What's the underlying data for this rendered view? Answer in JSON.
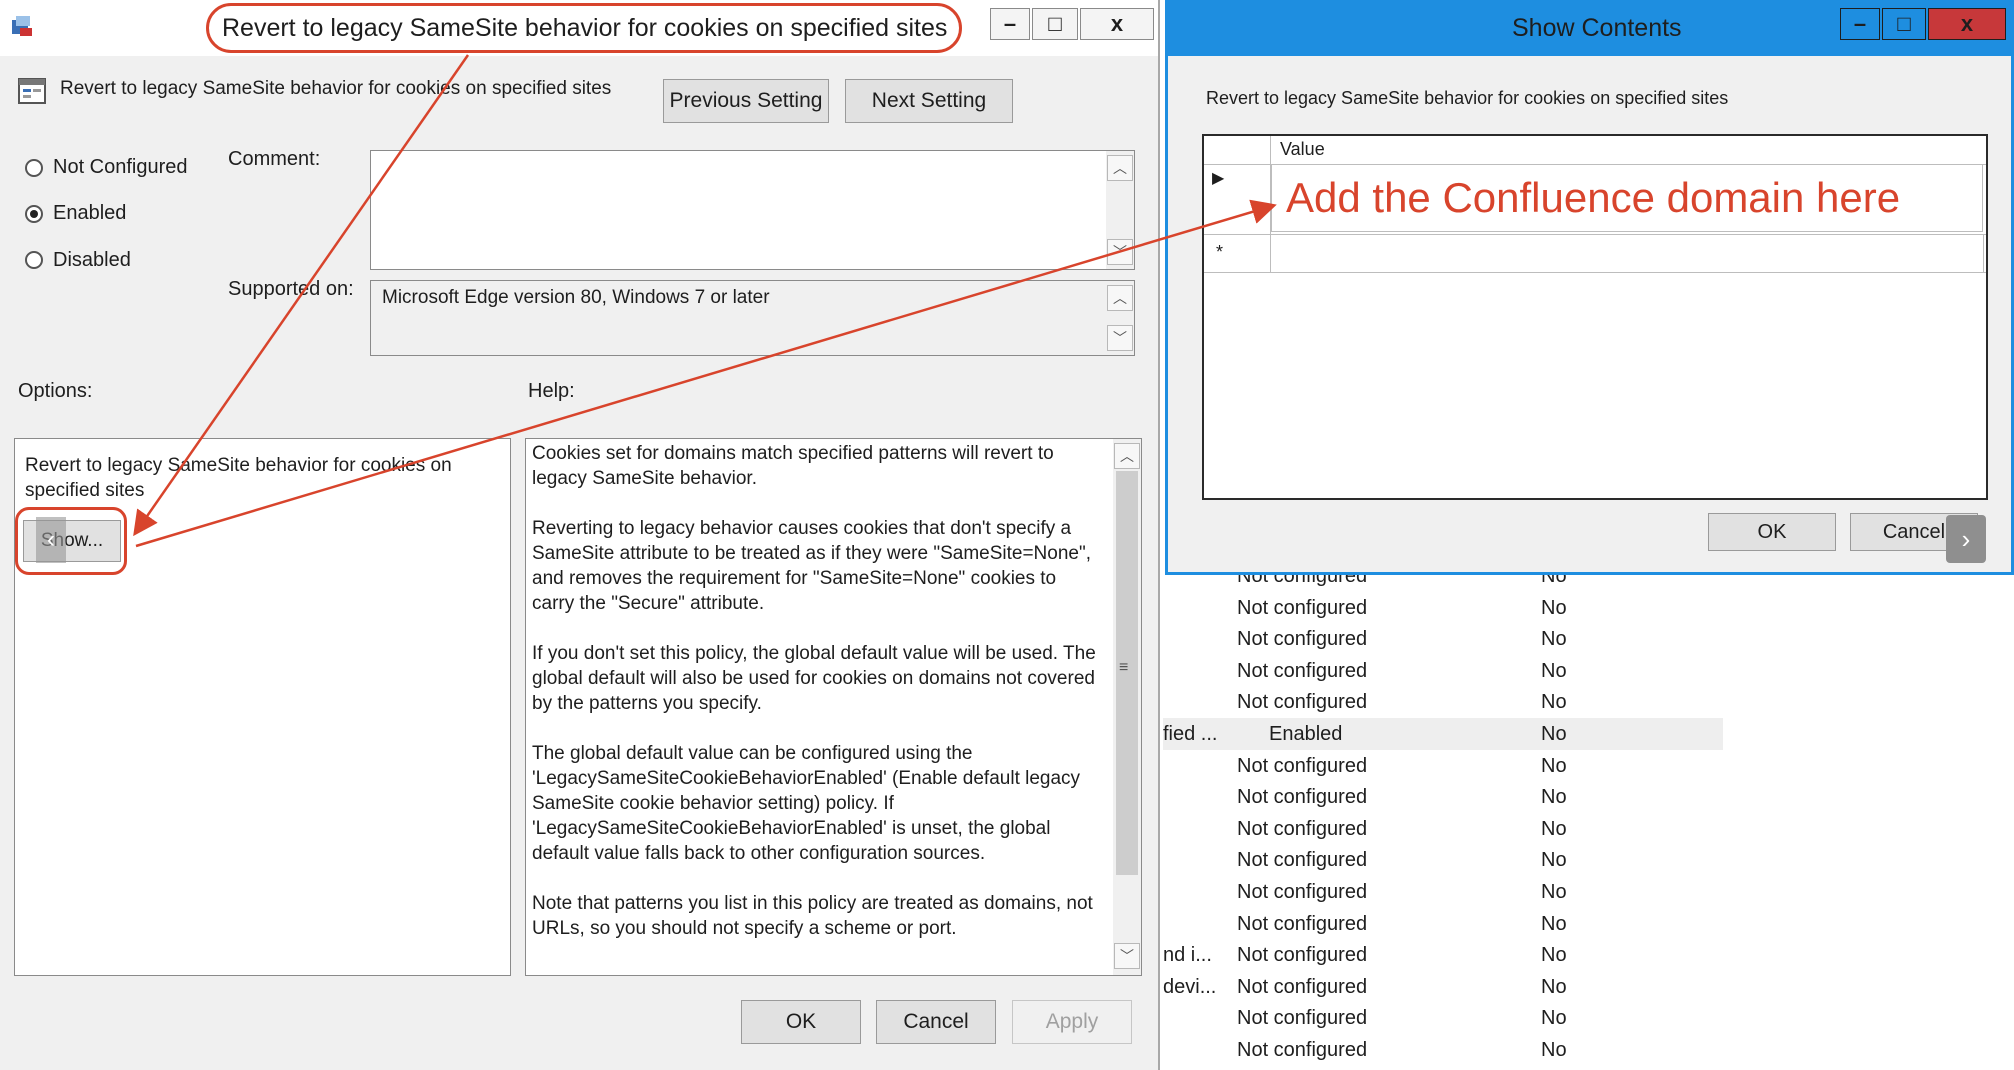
{
  "main_dialog": {
    "title": "Revert to legacy SameSite behavior for cookies on specified sites",
    "setting_name": "Revert to legacy SameSite behavior for cookies on specified sites",
    "previous_setting": "Previous Setting",
    "next_setting": "Next Setting",
    "radio_not_configured": "Not Configured",
    "radio_enabled": "Enabled",
    "radio_disabled": "Disabled",
    "selected_state": "Enabled",
    "comment_label": "Comment:",
    "supported_label": "Supported on:",
    "supported_value": "Microsoft Edge version 80, Windows 7 or later",
    "options_label": "Options:",
    "help_label": "Help:",
    "options_text": "Revert to legacy SameSite behavior for cookies on specified sites",
    "show_button": "Show...",
    "help_paragraphs": [
      "Cookies set for domains match specified patterns will revert to legacy SameSite behavior.",
      "Reverting to legacy behavior causes cookies that don't specify a SameSite attribute to be treated as if they were \"SameSite=None\", and removes the requirement for \"SameSite=None\" cookies to carry the \"Secure\" attribute.",
      "If you don't set this policy, the global default value will be used. The global default will also be used for cookies on domains not covered by the patterns you specify.",
      "The global default value can be configured using the 'LegacySameSiteCookieBehaviorEnabled' (Enable default legacy SameSite cookie behavior setting) policy. If 'LegacySameSiteCookieBehaviorEnabled' is unset, the global default value falls back to other configuration sources.",
      "Note that patterns you list in this policy are treated as domains, not URLs, so you should not specify a scheme or port."
    ],
    "ok": "OK",
    "cancel": "Cancel",
    "apply": "Apply"
  },
  "show_dialog": {
    "title": "Show Contents",
    "description": "Revert to legacy SameSite behavior for cookies on specified sites",
    "column_header": "Value",
    "annotation": "Add the Confluence domain here",
    "ok": "OK",
    "cancel": "Cancel"
  },
  "background_list": [
    {
      "name": "",
      "state": "Not configured",
      "comment": "No"
    },
    {
      "name": "",
      "state": "Not configured",
      "comment": "No"
    },
    {
      "name": "",
      "state": "Not configured",
      "comment": "No"
    },
    {
      "name": "",
      "state": "Not configured",
      "comment": "No"
    },
    {
      "name": "",
      "state": "Not configured",
      "comment": "No"
    },
    {
      "name": "fied ...",
      "state": "Enabled",
      "comment": "No",
      "selected": true
    },
    {
      "name": "",
      "state": "Not configured",
      "comment": "No"
    },
    {
      "name": "",
      "state": "Not configured",
      "comment": "No"
    },
    {
      "name": "",
      "state": "Not configured",
      "comment": "No"
    },
    {
      "name": "",
      "state": "Not configured",
      "comment": "No"
    },
    {
      "name": "",
      "state": "Not configured",
      "comment": "No"
    },
    {
      "name": "",
      "state": "Not configured",
      "comment": "No"
    },
    {
      "name": "nd i...",
      "state": "Not configured",
      "comment": "No"
    },
    {
      "name": "devi...",
      "state": "Not configured",
      "comment": "No"
    },
    {
      "name": "",
      "state": "Not configured",
      "comment": "No"
    },
    {
      "name": "",
      "state": "Not configured",
      "comment": "No"
    }
  ],
  "colors": {
    "annotation": "#d8442c",
    "titlebar_active": "#1e8ee0",
    "dialog_bg": "#f0f0f0"
  }
}
